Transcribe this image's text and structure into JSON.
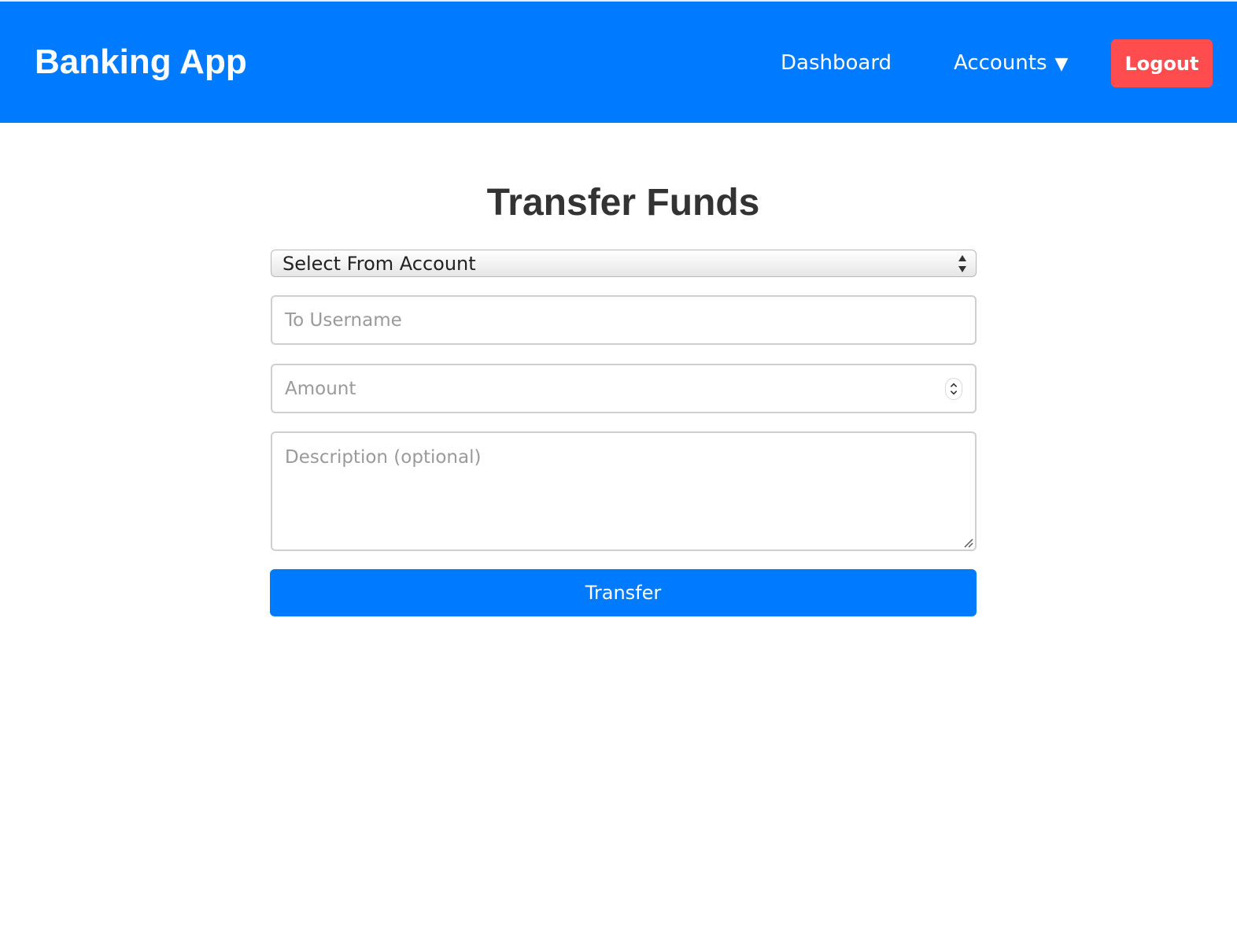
{
  "navbar": {
    "brand": "Banking App",
    "links": [
      {
        "label": "Dashboard"
      },
      {
        "label": "Accounts",
        "caret": "▼"
      }
    ],
    "logout_label": "Logout",
    "colors": {
      "background": "#007bff",
      "logout": "#ff4d4f"
    }
  },
  "main": {
    "title": "Transfer Funds",
    "from_account": {
      "selected": "Select From Account"
    },
    "to_username": {
      "placeholder": "To Username"
    },
    "amount": {
      "placeholder": "Amount"
    },
    "description": {
      "placeholder": "Description (optional)"
    },
    "submit_label": "Transfer",
    "colors": {
      "submit": "#007bff"
    }
  },
  "icons": {
    "select_arrows": "up-down-arrows-icon",
    "amount_spinner": "number-spinner-icon",
    "textarea_resize": "resize-handle-icon",
    "accounts_caret": "caret-down-icon"
  }
}
